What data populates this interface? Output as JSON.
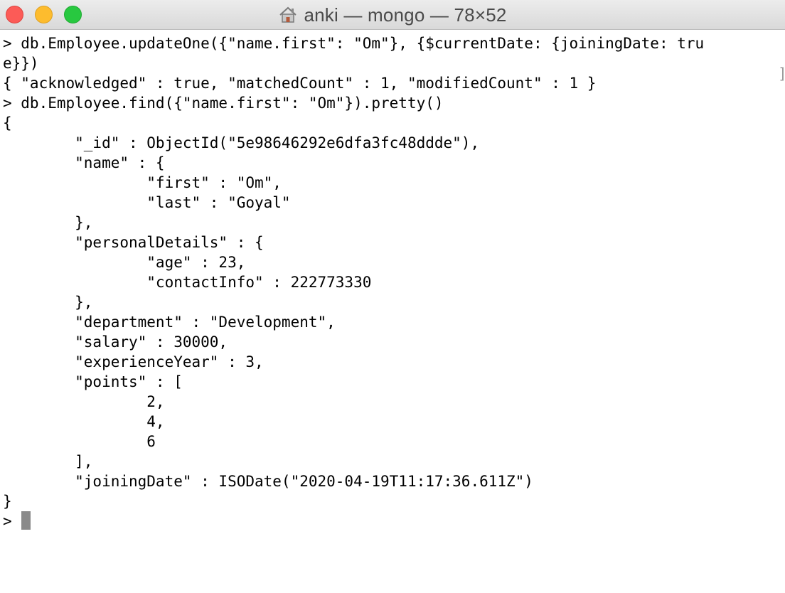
{
  "window": {
    "title": "anki — mongo — 78×52",
    "title_icon": "home-icon"
  },
  "terminal": {
    "lines": [
      "> db.Employee.updateOne({\"name.first\": \"Om\"}, {$currentDate: {joiningDate: tru",
      "e}})",
      "{ \"acknowledged\" : true, \"matchedCount\" : 1, \"modifiedCount\" : 1 }",
      "> db.Employee.find({\"name.first\": \"Om\"}).pretty()",
      "{",
      "        \"_id\" : ObjectId(\"5e98646292e6dfa3fc48ddde\"),",
      "        \"name\" : {",
      "                \"first\" : \"Om\",",
      "                \"last\" : \"Goyal\"",
      "        },",
      "        \"personalDetails\" : {",
      "                \"age\" : 23,",
      "                \"contactInfo\" : 222773330",
      "        },",
      "        \"department\" : \"Development\",",
      "        \"salary\" : 30000,",
      "        \"experienceYear\" : 3,",
      "        \"points\" : [",
      "                2,",
      "                4,",
      "                6",
      "        ],",
      "        \"joiningDate\" : ISODate(\"2020-04-19T11:17:36.611Z\")",
      "}"
    ],
    "prompt": "> ",
    "scroll_marker": "]"
  },
  "colors": {
    "close": "#fc5b57",
    "minimize": "#fdbc2e",
    "maximize": "#28c840",
    "cursor": "#8a8a8a"
  }
}
